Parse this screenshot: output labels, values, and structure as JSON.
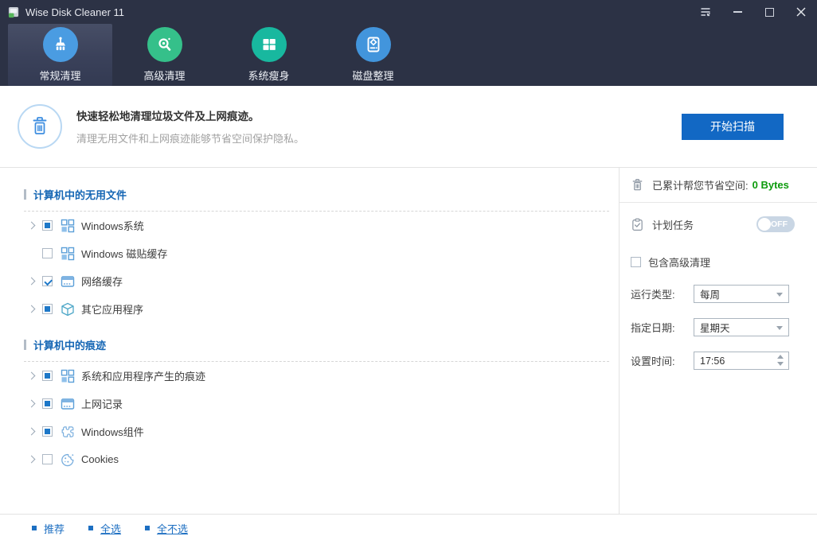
{
  "window": {
    "title": "Wise Disk Cleaner 11"
  },
  "nav": {
    "tabs": [
      {
        "label": "常规清理",
        "active": true
      },
      {
        "label": "高级清理",
        "active": false
      },
      {
        "label": "系统瘦身",
        "active": false
      },
      {
        "label": "磁盘整理",
        "active": false
      }
    ]
  },
  "header": {
    "title": "快速轻松地清理垃圾文件及上网痕迹。",
    "subtitle": "清理无用文件和上网痕迹能够节省空间保护隐私。",
    "scan_button": "开始扫描"
  },
  "tree": {
    "sections": [
      {
        "title": "计算机中的无用文件",
        "items": [
          {
            "label": "Windows系统",
            "state": "partial",
            "expandable": true,
            "icon": "windows-icon"
          },
          {
            "label": "Windows 磁贴缓存",
            "state": "empty",
            "expandable": false,
            "icon": "windows-icon"
          },
          {
            "label": "网络缓存",
            "state": "checked",
            "expandable": true,
            "icon": "browser-icon"
          },
          {
            "label": "其它应用程序",
            "state": "partial",
            "expandable": true,
            "icon": "apps-cube-icon"
          }
        ]
      },
      {
        "title": "计算机中的痕迹",
        "items": [
          {
            "label": "系统和应用程序产生的痕迹",
            "state": "partial",
            "expandable": true,
            "icon": "windows-icon"
          },
          {
            "label": "上网记录",
            "state": "partial",
            "expandable": true,
            "icon": "browser-icon"
          },
          {
            "label": "Windows组件",
            "state": "partial",
            "expandable": true,
            "icon": "puzzle-icon"
          },
          {
            "label": "Cookies",
            "state": "empty",
            "expandable": true,
            "icon": "cookie-icon"
          }
        ]
      }
    ]
  },
  "panel": {
    "saved_label": "已累计帮您节省空间:",
    "saved_value": "0 Bytes",
    "schedule": {
      "label": "计划任务",
      "toggle_state": "off",
      "toggle_label": "OFF"
    },
    "include_advanced": {
      "label": "包含高级清理",
      "checked": false
    },
    "fields": {
      "run_type": {
        "label": "运行类型:",
        "value": "每周"
      },
      "day": {
        "label": "指定日期:",
        "value": "星期天"
      },
      "time": {
        "label": "设置时间:",
        "value": "17:56"
      }
    }
  },
  "footer": {
    "links": [
      {
        "label": "推荐"
      },
      {
        "label": "全选"
      },
      {
        "label": "全不选"
      }
    ]
  },
  "colors": {
    "nav_bg": "#2c3245",
    "accent": "#1268c4",
    "saved_green": "#0d9b0d",
    "tab_regular": "#4a9ce2",
    "tab_advanced": "#35c08a",
    "tab_slim": "#18b89f",
    "tab_defrag": "#4295dc",
    "link_blue": "#1d6fc2"
  }
}
